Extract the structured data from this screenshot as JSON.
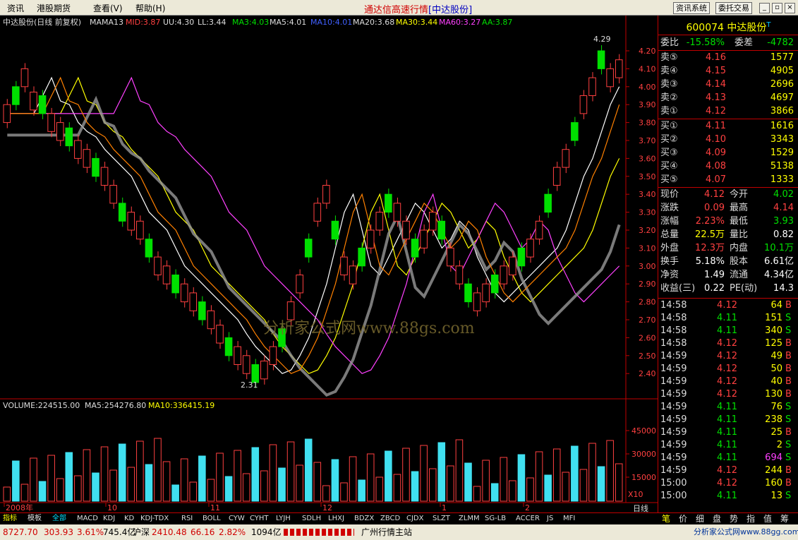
{
  "menus": [
    "资讯",
    "港股期货",
    "查看(V)",
    "帮助(H)"
  ],
  "app_title": "通达信高速行情",
  "app_title_code": "[中达股份]",
  "toolbar_buttons": [
    "资讯系统",
    "委托交易"
  ],
  "chart_header": {
    "name": "中达股份(日线 前复权)",
    "indicator": "MAMA13",
    "mid": "MID:3.87",
    "uu": "UU:4.30",
    "ll": "LL:3.44",
    "ma3": "MA3:4.03",
    "ma5": "MA5:4.01",
    "ma10": "MA10:4.01",
    "ma20": "MA20:3.68",
    "ma30": "MA30:3.44",
    "ma60": "MA60:3.27",
    "aa": "AA:3.87"
  },
  "price_axis": [
    "4.20",
    "4.10",
    "4.00",
    "3.90",
    "3.80",
    "3.70",
    "3.60",
    "3.50",
    "3.40",
    "3.30",
    "3.20",
    "3.10",
    "3.00",
    "2.90",
    "2.80",
    "2.70",
    "2.60",
    "2.50",
    "2.40"
  ],
  "annotations": {
    "high": "4.29",
    "low": "2.31"
  },
  "watermark": "分析家公式网www.88gs.com",
  "volume_header": {
    "volume": "VOLUME:224515.00",
    "ma5": "MA5:254276.80",
    "ma10": "MA10:336415.19"
  },
  "volume_axis": [
    "45000",
    "30000",
    "15000"
  ],
  "volume_unit": "X10",
  "date_axis": [
    "2008年",
    "10",
    "11",
    "12",
    "1",
    "2"
  ],
  "period": "日线",
  "bottom_tabs": [
    "指标",
    "模板",
    "全部",
    "MACD",
    "KDJ",
    "KD",
    "KDJ-TDX",
    "RSI",
    "BOLL",
    "CYW",
    "CYHT",
    "LYJH",
    "SDLH",
    "LHXJ",
    "BDZX",
    "ZBCD",
    "CJDX",
    "SLZT",
    "ZLMM",
    "SG-LB",
    "ACCER",
    "JS",
    "MFI"
  ],
  "side_tabs": [
    "笔",
    "价",
    "细",
    "盘",
    "势",
    "指",
    "值",
    "筹"
  ],
  "quote": {
    "code": "600074",
    "name": "中达股份",
    "mark": "T",
    "weibi_label": "委比",
    "weibi": "-15.58%",
    "weicha_label": "委差",
    "weicha": "-4782",
    "asks": [
      {
        "label": "卖⑤",
        "price": "4.16",
        "vol": "1577"
      },
      {
        "label": "卖④",
        "price": "4.15",
        "vol": "4905"
      },
      {
        "label": "卖③",
        "price": "4.14",
        "vol": "2696"
      },
      {
        "label": "卖②",
        "price": "4.13",
        "vol": "4697"
      },
      {
        "label": "卖①",
        "price": "4.12",
        "vol": "3866"
      }
    ],
    "bids": [
      {
        "label": "买①",
        "price": "4.11",
        "vol": "1616"
      },
      {
        "label": "买②",
        "price": "4.10",
        "vol": "3343"
      },
      {
        "label": "买③",
        "price": "4.09",
        "vol": "1529"
      },
      {
        "label": "买④",
        "price": "4.08",
        "vol": "5138"
      },
      {
        "label": "买⑤",
        "price": "4.07",
        "vol": "1333"
      }
    ],
    "stats": [
      {
        "k": "现价",
        "v": "4.12",
        "vc": "red",
        "k2": "今开",
        "v2": "4.02",
        "v2c": "grn"
      },
      {
        "k": "涨跌",
        "v": "0.09",
        "vc": "red",
        "k2": "最高",
        "v2": "4.14",
        "v2c": "red"
      },
      {
        "k": "涨幅",
        "v": "2.23%",
        "vc": "red",
        "k2": "最低",
        "v2": "3.93",
        "v2c": "grn"
      },
      {
        "k": "总量",
        "v": "22.5万",
        "vc": "yel",
        "k2": "量比",
        "v2": "0.82",
        "v2c": "wht"
      },
      {
        "k": "外盘",
        "v": "12.3万",
        "vc": "red",
        "k2": "内盘",
        "v2": "10.1万",
        "v2c": "grn"
      },
      {
        "k": "换手",
        "v": "5.18%",
        "vc": "wht",
        "k2": "股本",
        "v2": "6.61亿",
        "v2c": "wht"
      },
      {
        "k": "净资",
        "v": "1.49",
        "vc": "wht",
        "k2": "流通",
        "v2": "4.34亿",
        "v2c": "wht"
      },
      {
        "k": "收益(三)",
        "v": "0.22",
        "vc": "wht",
        "k2": "PE(动)",
        "v2": "14.3",
        "v2c": "wht"
      }
    ],
    "ticks": [
      {
        "t": "14:58",
        "p": "4.12",
        "v": "64",
        "bs": "B"
      },
      {
        "t": "14:58",
        "p": "4.11",
        "v": "151",
        "bs": "S"
      },
      {
        "t": "14:58",
        "p": "4.11",
        "v": "340",
        "bs": "S"
      },
      {
        "t": "14:58",
        "p": "4.12",
        "v": "125",
        "bs": "B"
      },
      {
        "t": "14:59",
        "p": "4.12",
        "v": "49",
        "bs": "B"
      },
      {
        "t": "14:59",
        "p": "4.12",
        "v": "50",
        "bs": "B"
      },
      {
        "t": "14:59",
        "p": "4.12",
        "v": "40",
        "bs": "B"
      },
      {
        "t": "14:59",
        "p": "4.12",
        "v": "130",
        "bs": "B"
      },
      {
        "t": "14:59",
        "p": "4.11",
        "v": "76",
        "bs": "S"
      },
      {
        "t": "14:59",
        "p": "4.11",
        "v": "238",
        "bs": "S"
      },
      {
        "t": "14:59",
        "p": "4.11",
        "v": "25",
        "bs": "B"
      },
      {
        "t": "14:59",
        "p": "4.11",
        "v": "2",
        "bs": "S"
      },
      {
        "t": "14:59",
        "p": "4.11",
        "v": "694",
        "bs": "S"
      },
      {
        "t": "14:59",
        "p": "4.12",
        "v": "244",
        "bs": "B"
      },
      {
        "t": "15:00",
        "p": "4.12",
        "v": "160",
        "bs": "B"
      },
      {
        "t": "15:00",
        "p": "4.11",
        "v": "13",
        "bs": "S"
      }
    ]
  },
  "status": {
    "idx1": "8727.70",
    "idx1_chg": "303.93",
    "idx1_pct": "3.61%",
    "idx1_amt": "745.4亿",
    "idx2_name": "沪深",
    "idx2": "2410.48",
    "idx2_chg": "66.16",
    "idx2_pct": "2.82%",
    "idx2_amt": "1094亿",
    "server": "广州行情主站",
    "brand": "分析家公式网www.88gg.com"
  },
  "colors": {
    "up": "#ff4040",
    "down": "#00e000",
    "accent": "#c00000"
  }
}
